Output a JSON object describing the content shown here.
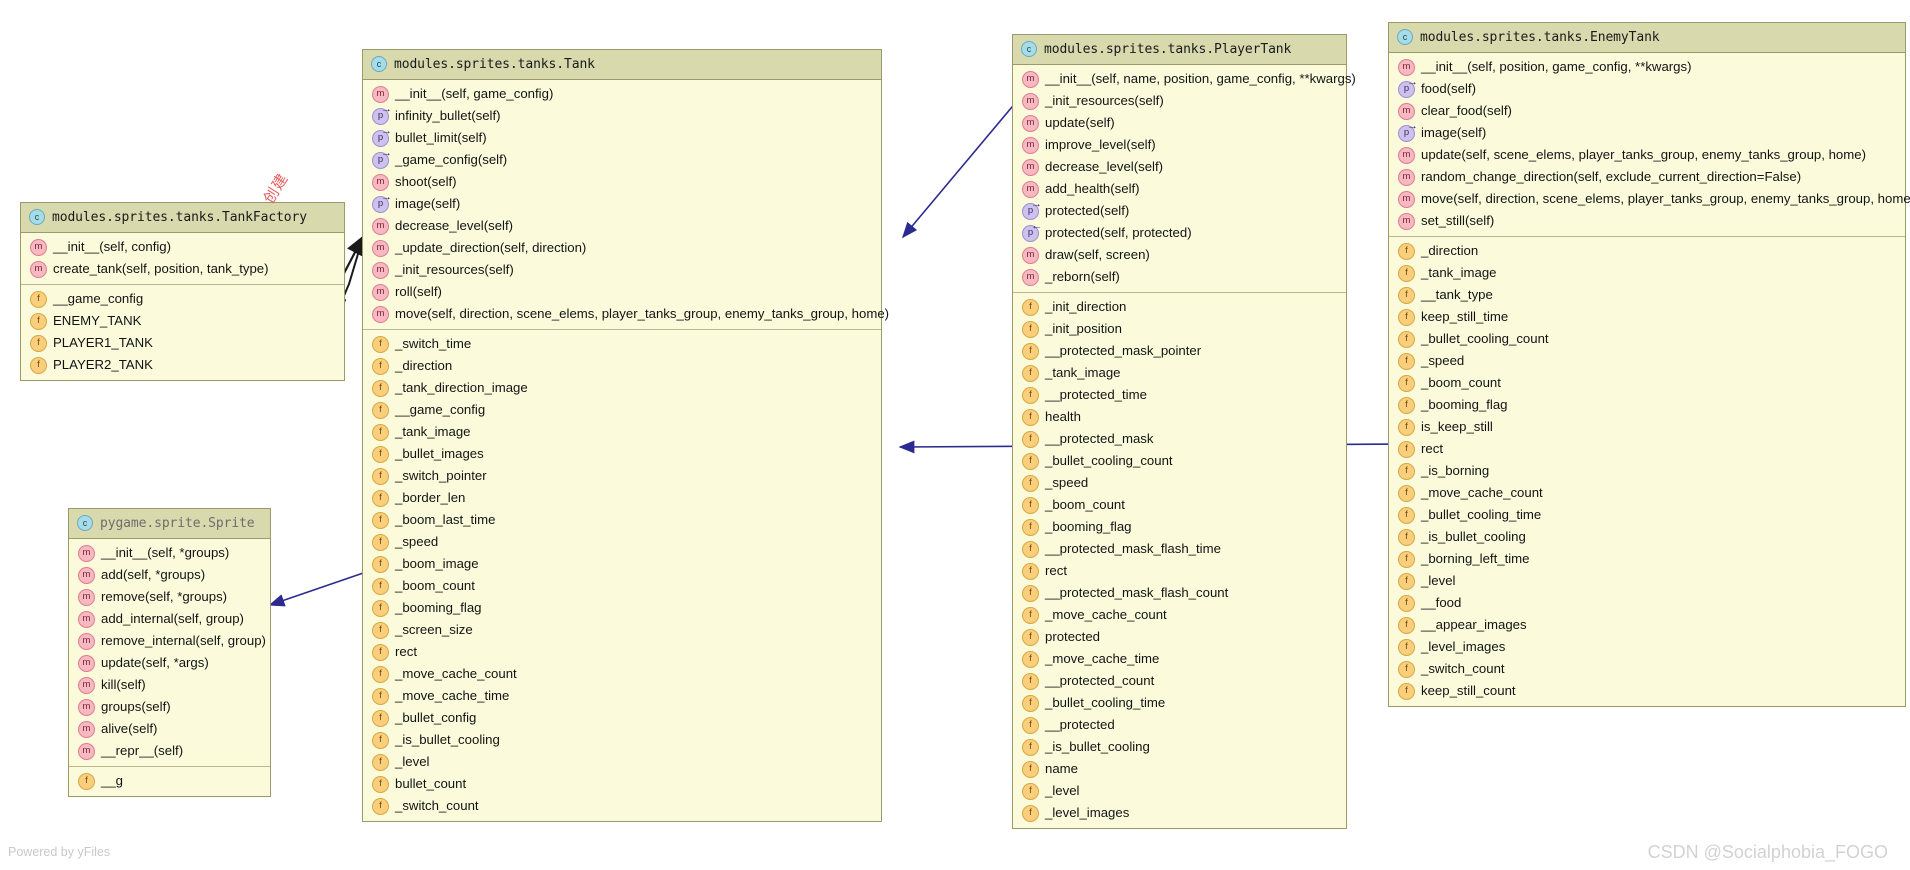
{
  "diagram": {
    "tool_credit": "Powered by yFiles",
    "watermark": "CSDN @Socialphobia_FOGO",
    "annotation_cn": "创建",
    "edge_color": "#2b2b8f"
  },
  "classes": {
    "tank_factory": {
      "title": "modules.sprites.tanks.TankFactory",
      "methods": [
        {
          "icon": "method",
          "label": "__init__(self, config)"
        },
        {
          "icon": "method",
          "label": "create_tank(self, position, tank_type)"
        }
      ],
      "fields": [
        {
          "icon": "field",
          "label": "__game_config"
        },
        {
          "icon": "field",
          "label": "ENEMY_TANK"
        },
        {
          "icon": "field",
          "label": "PLAYER1_TANK"
        },
        {
          "icon": "field",
          "label": "PLAYER2_TANK"
        }
      ]
    },
    "sprite": {
      "title": "pygame.sprite.Sprite",
      "methods": [
        {
          "icon": "method",
          "label": "__init__(self, *groups)"
        },
        {
          "icon": "method",
          "label": "add(self, *groups)"
        },
        {
          "icon": "method",
          "label": "remove(self, *groups)"
        },
        {
          "icon": "method",
          "label": "add_internal(self, group)"
        },
        {
          "icon": "method",
          "label": "remove_internal(self, group)"
        },
        {
          "icon": "method",
          "label": "update(self, *args)"
        },
        {
          "icon": "method",
          "label": "kill(self)"
        },
        {
          "icon": "method",
          "label": "groups(self)"
        },
        {
          "icon": "method",
          "label": "alive(self)"
        },
        {
          "icon": "method",
          "label": "__repr__(self)"
        }
      ],
      "fields": [
        {
          "icon": "field",
          "label": "__g"
        }
      ]
    },
    "tank": {
      "title": "modules.sprites.tanks.Tank",
      "methods": [
        {
          "icon": "method",
          "label": "__init__(self, game_config)"
        },
        {
          "icon": "property",
          "label": "infinity_bullet(self)"
        },
        {
          "icon": "property",
          "label": "bullet_limit(self)"
        },
        {
          "icon": "property",
          "label": "_game_config(self)"
        },
        {
          "icon": "method",
          "label": "shoot(self)"
        },
        {
          "icon": "property",
          "label": "image(self)"
        },
        {
          "icon": "method",
          "label": "decrease_level(self)"
        },
        {
          "icon": "method",
          "label": "_update_direction(self, direction)"
        },
        {
          "icon": "method",
          "label": "_init_resources(self)"
        },
        {
          "icon": "method",
          "label": "roll(self)"
        },
        {
          "icon": "method",
          "label": "move(self, direction, scene_elems, player_tanks_group, enemy_tanks_group, home)"
        }
      ],
      "fields": [
        {
          "icon": "field",
          "label": "_switch_time"
        },
        {
          "icon": "field",
          "label": "_direction"
        },
        {
          "icon": "field",
          "label": "_tank_direction_image"
        },
        {
          "icon": "field",
          "label": "__game_config"
        },
        {
          "icon": "field",
          "label": "_tank_image"
        },
        {
          "icon": "field",
          "label": "_bullet_images"
        },
        {
          "icon": "field",
          "label": "_switch_pointer"
        },
        {
          "icon": "field",
          "label": "_border_len"
        },
        {
          "icon": "field",
          "label": "_boom_last_time"
        },
        {
          "icon": "field",
          "label": "_speed"
        },
        {
          "icon": "field",
          "label": "_boom_image"
        },
        {
          "icon": "field",
          "label": "_boom_count"
        },
        {
          "icon": "field",
          "label": "_booming_flag"
        },
        {
          "icon": "field",
          "label": "_screen_size"
        },
        {
          "icon": "field",
          "label": "rect"
        },
        {
          "icon": "field",
          "label": "_move_cache_count"
        },
        {
          "icon": "field",
          "label": "_move_cache_time"
        },
        {
          "icon": "field",
          "label": "_bullet_config"
        },
        {
          "icon": "field",
          "label": "_is_bullet_cooling"
        },
        {
          "icon": "field",
          "label": "_level"
        },
        {
          "icon": "field",
          "label": "bullet_count"
        },
        {
          "icon": "field",
          "label": "_switch_count"
        }
      ]
    },
    "player_tank": {
      "title": "modules.sprites.tanks.PlayerTank",
      "methods": [
        {
          "icon": "method",
          "label": "__init__(self, name, position, game_config, **kwargs)"
        },
        {
          "icon": "method",
          "label": "_init_resources(self)"
        },
        {
          "icon": "method",
          "label": "update(self)"
        },
        {
          "icon": "method",
          "label": "improve_level(self)"
        },
        {
          "icon": "method",
          "label": "decrease_level(self)"
        },
        {
          "icon": "method",
          "label": "add_health(self)"
        },
        {
          "icon": "property",
          "label": "protected(self)"
        },
        {
          "icon": "property-setter",
          "label": "protected(self, protected)"
        },
        {
          "icon": "method",
          "label": "draw(self, screen)"
        },
        {
          "icon": "method",
          "label": "_reborn(self)"
        }
      ],
      "fields": [
        {
          "icon": "field",
          "label": "_init_direction"
        },
        {
          "icon": "field",
          "label": "_init_position"
        },
        {
          "icon": "field",
          "label": "__protected_mask_pointer"
        },
        {
          "icon": "field",
          "label": "_tank_image"
        },
        {
          "icon": "field",
          "label": "__protected_time"
        },
        {
          "icon": "field",
          "label": "health"
        },
        {
          "icon": "field",
          "label": "__protected_mask"
        },
        {
          "icon": "field",
          "label": "_bullet_cooling_count"
        },
        {
          "icon": "field",
          "label": "_speed"
        },
        {
          "icon": "field",
          "label": "_boom_count"
        },
        {
          "icon": "field",
          "label": "_booming_flag"
        },
        {
          "icon": "field",
          "label": "__protected_mask_flash_time"
        },
        {
          "icon": "field",
          "label": "rect"
        },
        {
          "icon": "field",
          "label": "__protected_mask_flash_count"
        },
        {
          "icon": "field",
          "label": "_move_cache_count"
        },
        {
          "icon": "field",
          "label": "protected"
        },
        {
          "icon": "field",
          "label": "_move_cache_time"
        },
        {
          "icon": "field",
          "label": "__protected_count"
        },
        {
          "icon": "field",
          "label": "_bullet_cooling_time"
        },
        {
          "icon": "field",
          "label": "__protected"
        },
        {
          "icon": "field",
          "label": "_is_bullet_cooling"
        },
        {
          "icon": "field",
          "label": "name"
        },
        {
          "icon": "field",
          "label": "_level"
        },
        {
          "icon": "field",
          "label": "_level_images"
        }
      ]
    },
    "enemy_tank": {
      "title": "modules.sprites.tanks.EnemyTank",
      "methods": [
        {
          "icon": "method",
          "label": "__init__(self, position, game_config, **kwargs)"
        },
        {
          "icon": "property",
          "label": "food(self)"
        },
        {
          "icon": "method",
          "label": "clear_food(self)"
        },
        {
          "icon": "property",
          "label": "image(self)"
        },
        {
          "icon": "method",
          "label": "update(self, scene_elems, player_tanks_group, enemy_tanks_group, home)"
        },
        {
          "icon": "method",
          "label": "random_change_direction(self, exclude_current_direction=False)"
        },
        {
          "icon": "method",
          "label": "move(self, direction, scene_elems, player_tanks_group, enemy_tanks_group, home)"
        },
        {
          "icon": "method",
          "label": "set_still(self)"
        }
      ],
      "fields": [
        {
          "icon": "field",
          "label": "_direction"
        },
        {
          "icon": "field",
          "label": "_tank_image"
        },
        {
          "icon": "field",
          "label": "__tank_type"
        },
        {
          "icon": "field",
          "label": "keep_still_time"
        },
        {
          "icon": "field",
          "label": "_bullet_cooling_count"
        },
        {
          "icon": "field",
          "label": "_speed"
        },
        {
          "icon": "field",
          "label": "_boom_count"
        },
        {
          "icon": "field",
          "label": "_booming_flag"
        },
        {
          "icon": "field",
          "label": "is_keep_still"
        },
        {
          "icon": "field",
          "label": "rect"
        },
        {
          "icon": "field",
          "label": "_is_borning"
        },
        {
          "icon": "field",
          "label": "_move_cache_count"
        },
        {
          "icon": "field",
          "label": "_bullet_cooling_time"
        },
        {
          "icon": "field",
          "label": "_is_bullet_cooling"
        },
        {
          "icon": "field",
          "label": "_borning_left_time"
        },
        {
          "icon": "field",
          "label": "_level"
        },
        {
          "icon": "field",
          "label": "__food"
        },
        {
          "icon": "field",
          "label": "__appear_images"
        },
        {
          "icon": "field",
          "label": "_level_images"
        },
        {
          "icon": "field",
          "label": "_switch_count"
        },
        {
          "icon": "field",
          "label": "keep_still_count"
        }
      ]
    }
  }
}
